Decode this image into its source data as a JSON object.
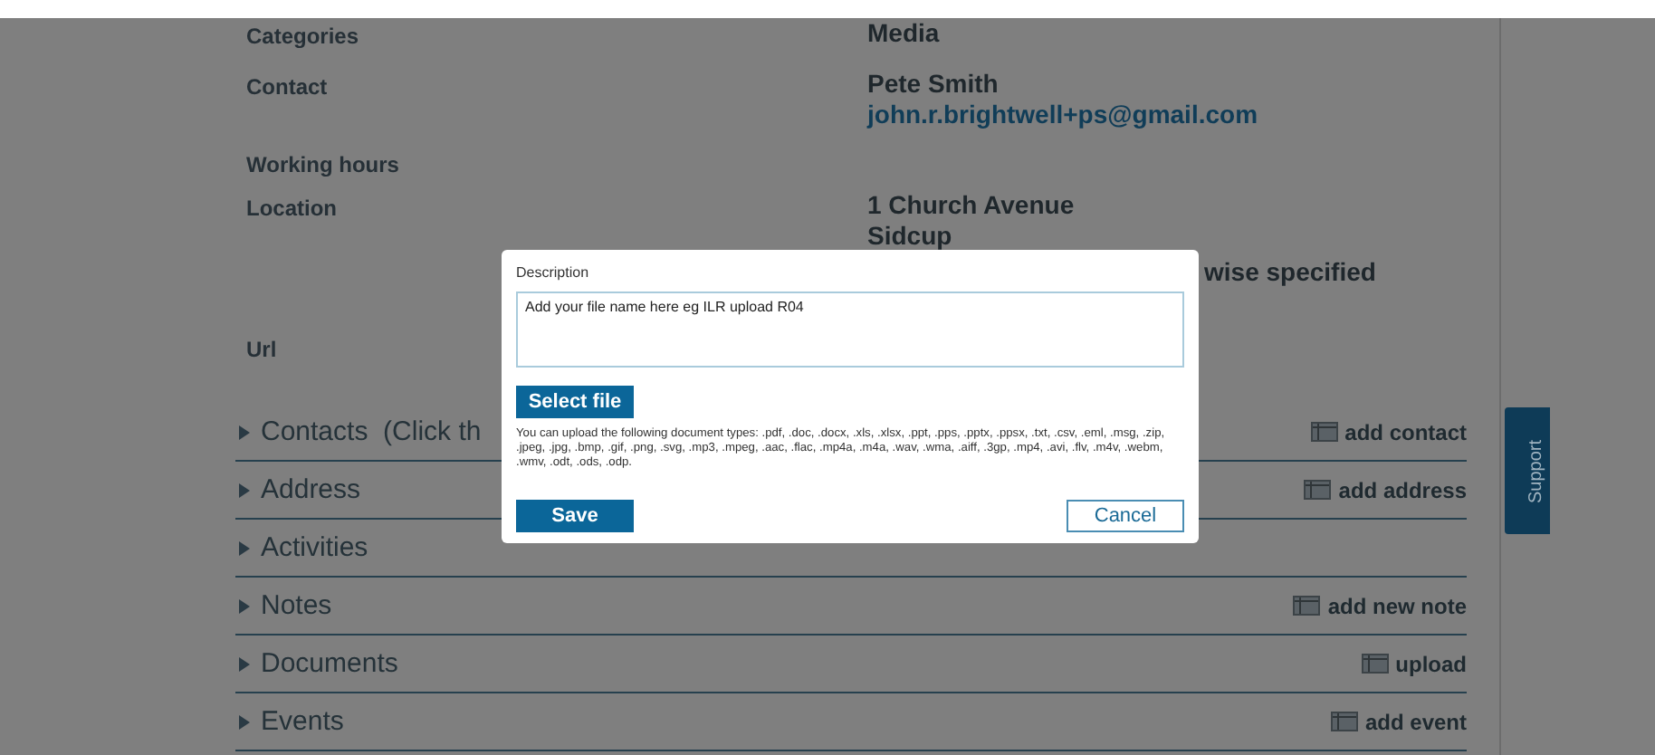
{
  "details": [
    {
      "label": "Categories",
      "values": [
        "Media"
      ]
    },
    {
      "label": "Contact",
      "values": [
        "Pete Smith"
      ],
      "link": "john.r.brightwell+ps@gmail.com"
    },
    {
      "label": "Working hours"
    },
    {
      "label": "Location",
      "values": [
        "1 Church Avenue",
        "Sidcup"
      ],
      "continuation": "wise specified"
    },
    {
      "label": "Url"
    }
  ],
  "sections": [
    {
      "title": "Contacts  (Click th",
      "action": "add contact"
    },
    {
      "title": "Address",
      "action": "add address"
    },
    {
      "title": "Activities"
    },
    {
      "title": "Notes",
      "action": "add new note"
    },
    {
      "title": "Documents",
      "action": "upload"
    },
    {
      "title": "Events",
      "action": "add event"
    }
  ],
  "support_tab": "Support",
  "dialog": {
    "description_label": "Description",
    "description_value": "Add your file name here eg ILR upload R04",
    "select_button": "Select file",
    "note": "You can upload the following document types: .pdf, .doc, .docx, .xls, .xlsx, .ppt, .pps, .pptx, .ppsx, .txt, .csv, .eml, .msg, .zip, .jpeg, .jpg, .bmp, .gif, .png, .svg, .mp3, .mpeg, .aac, .flac, .mp4a, .m4a, .wav, .wma, .aiff, .3gp, .mp4, .avi, .flv, .m4v, .webm, .wmv, .odt, .ods, .odp.",
    "save_button": "Save",
    "cancel_button": "Cancel"
  }
}
